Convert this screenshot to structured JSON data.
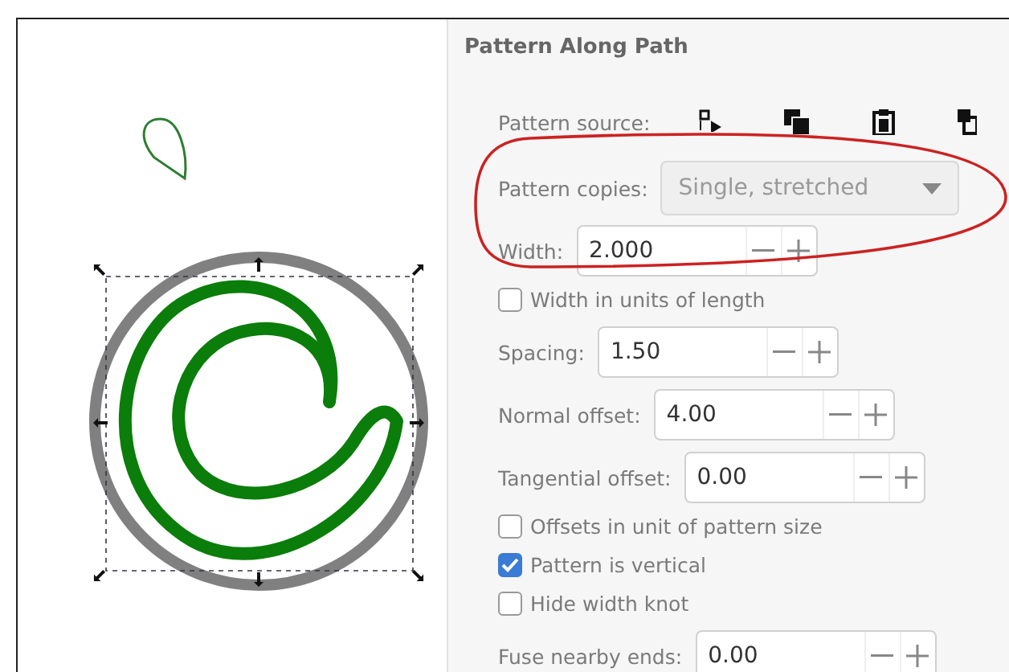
{
  "panel": {
    "title": "Pattern Along Path",
    "rows": [
      {
        "kind": "source",
        "label": "Pattern source:"
      },
      {
        "kind": "dropdown",
        "label": "Pattern copies:",
        "value": "Single, stretched",
        "disabled": true
      },
      {
        "kind": "spin",
        "label": "Width:",
        "value": "2.000"
      },
      {
        "kind": "check",
        "label": "Width in units of length",
        "checked": false
      },
      {
        "kind": "spin",
        "label": "Spacing:",
        "value": "1.50"
      },
      {
        "kind": "spin",
        "label": "Normal offset:",
        "value": "4.00"
      },
      {
        "kind": "spin",
        "label": "Tangential offset:",
        "value": "0.00"
      },
      {
        "kind": "check",
        "label": "Offsets in unit of pattern size",
        "checked": false
      },
      {
        "kind": "check",
        "label": "Pattern is vertical",
        "checked": true
      },
      {
        "kind": "check",
        "label": "Hide width knot",
        "checked": false
      },
      {
        "kind": "spin",
        "label": "Fuse nearby ends:",
        "value": "0.00"
      }
    ]
  }
}
